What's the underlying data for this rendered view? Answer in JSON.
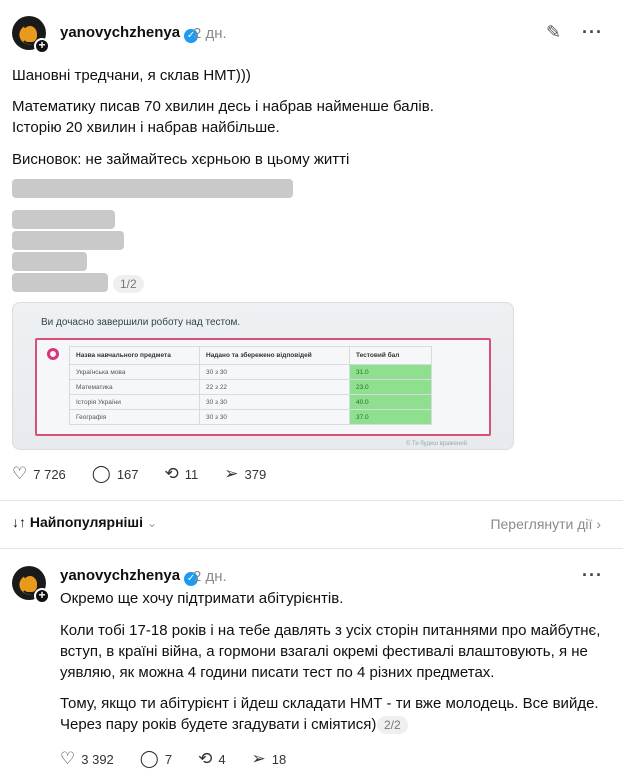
{
  "post": {
    "username": "yanovychzhenya",
    "time": "2 дн.",
    "lines": [
      "Шановні тредчани, я склав НМТ)))",
      "Математику писав 70 хвилин десь і набрав найменше балів.",
      "Історію 20 хвилин і набрав найбільше.",
      "Висновок: не займайтесь хєрньою в цьому житті"
    ],
    "page_badge": "1/2",
    "photo": {
      "heading": "Ви дочасно завершили роботу над тестом.",
      "columns": [
        "Назва навчального предмета",
        "Надано та збережено відповідей",
        "Тестовий бал"
      ],
      "rows": [
        [
          "Українська мова",
          "30 з 30",
          "31.0"
        ],
        [
          "Математика",
          "22 з 22",
          "23.0"
        ],
        [
          "Історія України",
          "30 з 30",
          "40.0"
        ],
        [
          "Географія",
          "30 з 30",
          "37.0"
        ]
      ],
      "footer": "© Ти будеш вражений"
    },
    "stats": {
      "likes": "7 726",
      "comments": "167",
      "reposts": "11",
      "shares": "379"
    }
  },
  "sort": {
    "label": "Найпопулярніші",
    "activity": "Переглянути дії"
  },
  "reply": {
    "username": "yanovychzhenya",
    "time": "2 дн.",
    "lines": [
      "Окремо ще хочу підтримати абітурієнтів.",
      "Коли тобі 17-18 років і на тебе давлять з усіх сторін питаннями про майбутнє,",
      "вступ, в країні війна, а гормони взагалі окремі фестивалі влаштовують, я не",
      "уявляю, як можна 4 години писати тест по 4 різних предметах.",
      "Тому, якщо ти абітурієнт і йдеш складати НМТ - ти вже молодець. Все вийде.",
      "Через пару років будете згадувати і сміятися)"
    ],
    "page_badge": "2/2",
    "stats": {
      "likes": "3 392",
      "comments": "7",
      "reposts": "4",
      "shares": "18"
    }
  },
  "icons": [
    "avatar-plus-icon",
    "verified-icon",
    "edit-icon",
    "more-icon",
    "heart-icon",
    "comment-icon",
    "repost-icon",
    "share-icon",
    "sort-icon",
    "chevron-down-icon",
    "chevron-right-icon"
  ],
  "colors": {
    "accent_verified": "#1d9bf0",
    "score_green": "#8ee08e",
    "frame_pink": "#d8507a"
  }
}
